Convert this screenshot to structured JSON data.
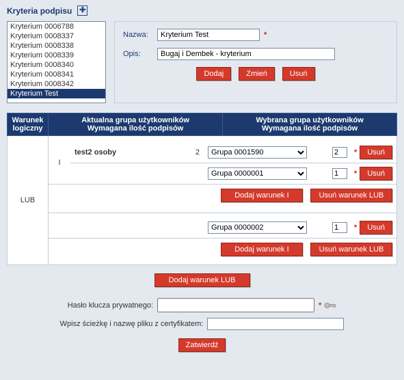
{
  "header": {
    "title": "Kryteria podpisu"
  },
  "criteria_list": {
    "items": [
      "Kryterium 0006788",
      "Kryterium 0008337",
      "Kryterium 0008338",
      "Kryterium 0008339",
      "Kryterium 0008340",
      "Kryterium 0008341",
      "Kryterium 0008342",
      "Kryterium Test"
    ],
    "selected_index": 7
  },
  "details": {
    "name_label": "Nazwa:",
    "name_value": "Kryterium Test",
    "desc_label": "Opis:",
    "desc_value": "Bugaj i Dembek - kryterium",
    "buttons": {
      "add": "Dodaj",
      "edit": "Zmień",
      "delete": "Usuń"
    }
  },
  "table": {
    "headers": {
      "logical": "Warunek logiczny",
      "current": "Aktualna grupa użytkowników\nWymagana ilość podpisów",
      "selected": "Wybrana grupa użytkowników\nWymagana ilość podpisów"
    },
    "lub_label": "LUB",
    "block1": {
      "cond_label": "I",
      "row1": {
        "current_text": "test2 osoby",
        "current_count": "2",
        "group": "Grupa 0001590",
        "count": "2"
      },
      "row2": {
        "group": "Grupa 0000001",
        "count": "1"
      }
    },
    "block2": {
      "row1": {
        "group": "Grupa 0000002",
        "count": "1"
      }
    },
    "btn_add_cond": "Dodaj warunek I",
    "btn_del_lub": "Usuń warunek LUB",
    "btn_del": "Usuń",
    "btn_add_lub": "Dodaj warunek LUB"
  },
  "footer": {
    "password_label": "Hasło klucza prywatnego:",
    "path_label": "Wpisz ścieżkę i nazwę pliku z certyfikatem:",
    "confirm": "Zatwierdź"
  }
}
